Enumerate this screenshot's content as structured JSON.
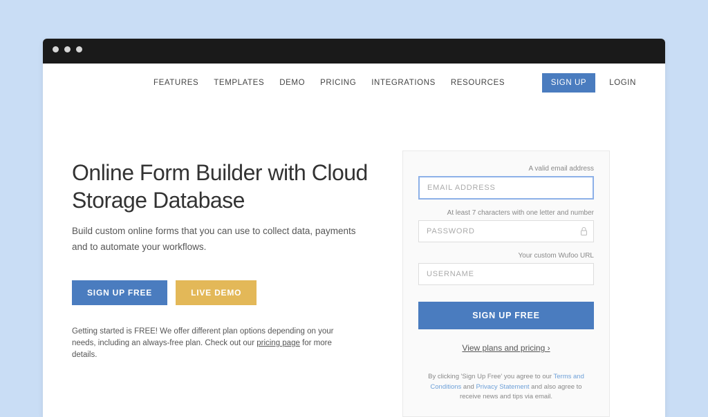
{
  "nav": {
    "items": [
      "FEATURES",
      "TEMPLATES",
      "DEMO",
      "PRICING",
      "INTEGRATIONS",
      "RESOURCES"
    ],
    "signup": "SIGN UP",
    "login": "LOGIN"
  },
  "hero": {
    "title": "Online Form Builder with Cloud Storage Database",
    "sub": "Build custom online forms that you can use to collect data, payments and to automate your workflows.",
    "btn_primary": "SIGN UP FREE",
    "btn_secondary": "LIVE DEMO",
    "note_pre": "Getting started is FREE! We offer different plan options depending on your needs, including an always-free plan. Check out our ",
    "note_link": "pricing page",
    "note_post": " for more details."
  },
  "form": {
    "email": {
      "hint": "A valid email address",
      "placeholder": "EMAIL ADDRESS"
    },
    "password": {
      "hint": "At least 7 characters with one letter and number",
      "placeholder": "PASSWORD"
    },
    "username": {
      "hint": "Your custom Wufoo URL",
      "placeholder": "USERNAME"
    },
    "submit": "SIGN UP FREE",
    "plans_link": "View plans and pricing ›",
    "terms_pre": "By clicking 'Sign Up Free' you agree to our ",
    "terms_link": "Terms and Conditions",
    "terms_and": " and ",
    "privacy_link": "Privacy Statement",
    "terms_post": " and also agree to receive news and tips via email."
  }
}
